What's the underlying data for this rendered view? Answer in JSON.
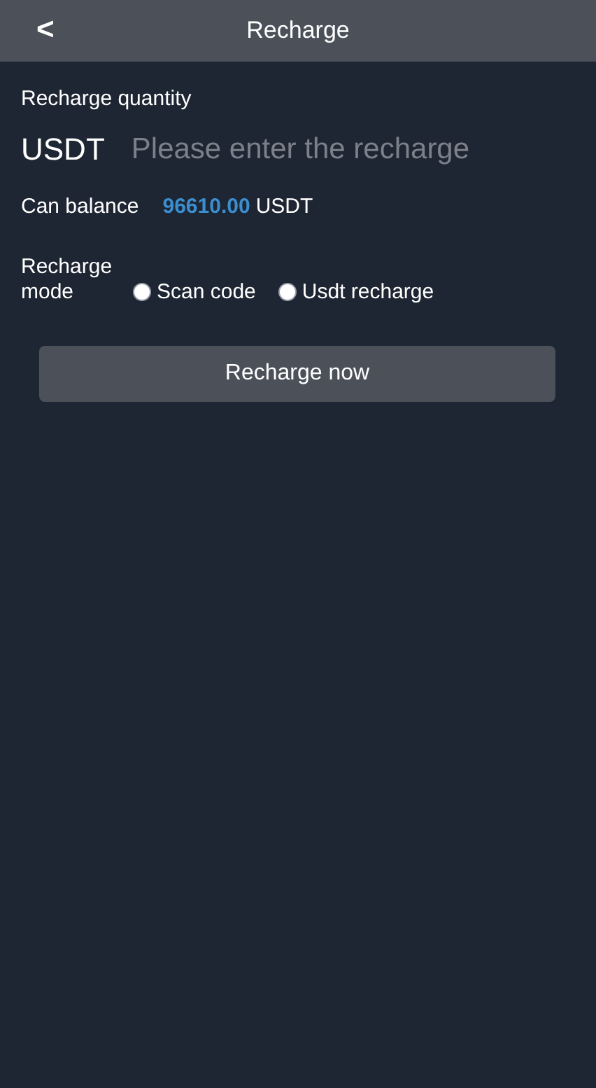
{
  "header": {
    "back": "<",
    "title": "Recharge"
  },
  "quantity": {
    "label": "Recharge quantity",
    "currency": "USDT",
    "placeholder": "Please enter the recharge"
  },
  "balance": {
    "label": "Can balance",
    "amount": "96610.00",
    "unit": "USDT"
  },
  "mode": {
    "label": "Recharge mode",
    "options": [
      {
        "label": "Scan code",
        "selected": false
      },
      {
        "label": "Usdt recharge",
        "selected": false
      }
    ]
  },
  "submit": "Recharge now"
}
